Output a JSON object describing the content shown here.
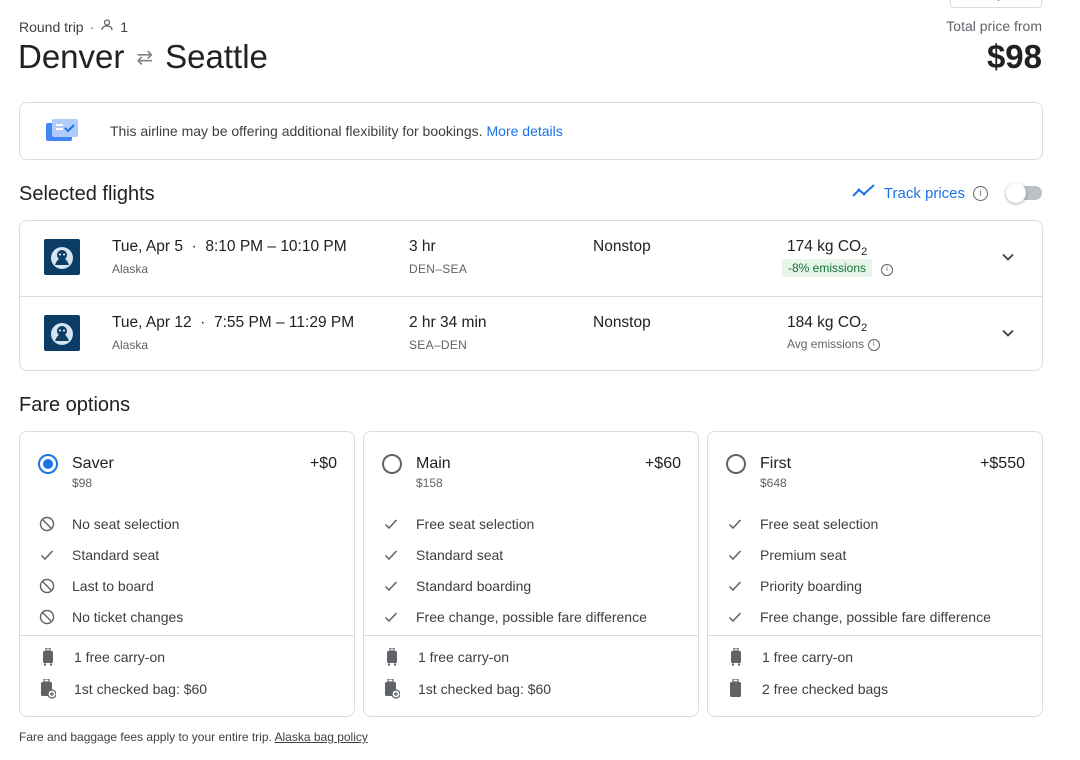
{
  "header": {
    "trip_type": "Round trip",
    "passengers": "1",
    "origin": "Denver",
    "destination": "Seattle",
    "total_price_label": "Total price from",
    "total_price": "$98"
  },
  "banner": {
    "text": "This airline may be offering additional flexibility for bookings.",
    "link": "More details"
  },
  "selected_flights": {
    "title": "Selected flights",
    "track_prices_label": "Track prices",
    "track_enabled": false,
    "flights": [
      {
        "date": "Tue, Apr 5",
        "times": "8:10 PM – 10:10 PM",
        "airline": "Alaska",
        "duration": "3 hr",
        "route": "DEN–SEA",
        "stops": "Nonstop",
        "co2_value": "174 kg CO",
        "emissions": "-8% emissions"
      },
      {
        "date": "Tue, Apr 12",
        "times": "7:55 PM – 11:29 PM",
        "airline": "Alaska",
        "duration": "2 hr 34 min",
        "route": "SEA–DEN",
        "stops": "Nonstop",
        "co2_value": "184 kg CO",
        "emissions": "Avg emissions"
      }
    ]
  },
  "fare_options": {
    "title": "Fare options",
    "fares": [
      {
        "name": "Saver",
        "base_price": "$98",
        "add_price": "+$0",
        "selected": true,
        "features": [
          {
            "icon": "block-icon",
            "text": "No seat selection"
          },
          {
            "icon": "check-icon",
            "text": "Standard seat"
          },
          {
            "icon": "block-icon",
            "text": "Last to board"
          },
          {
            "icon": "block-icon",
            "text": "No ticket changes"
          }
        ],
        "bags": [
          {
            "icon": "carry-on-icon",
            "text": "1 free carry-on"
          },
          {
            "icon": "checked-bag-fee-icon",
            "text": "1st checked bag: $60"
          }
        ]
      },
      {
        "name": "Main",
        "base_price": "$158",
        "add_price": "+$60",
        "selected": false,
        "features": [
          {
            "icon": "check-icon",
            "text": "Free seat selection"
          },
          {
            "icon": "check-icon",
            "text": "Standard seat"
          },
          {
            "icon": "check-icon",
            "text": "Standard boarding"
          },
          {
            "icon": "check-icon",
            "text": "Free change, possible fare difference"
          }
        ],
        "bags": [
          {
            "icon": "carry-on-icon",
            "text": "1 free carry-on"
          },
          {
            "icon": "checked-bag-fee-icon",
            "text": "1st checked bag: $60"
          }
        ]
      },
      {
        "name": "First",
        "base_price": "$648",
        "add_price": "+$550",
        "selected": false,
        "features": [
          {
            "icon": "check-icon",
            "text": "Free seat selection"
          },
          {
            "icon": "check-icon",
            "text": "Premium seat"
          },
          {
            "icon": "check-icon",
            "text": "Priority boarding"
          },
          {
            "icon": "check-icon",
            "text": "Free change, possible fare difference"
          }
        ],
        "bags": [
          {
            "icon": "carry-on-icon",
            "text": "1 free carry-on"
          },
          {
            "icon": "checked-bag-icon",
            "text": "2 free checked bags"
          }
        ]
      }
    ]
  },
  "footer": {
    "note": "Fare and baggage fees apply to your entire trip.",
    "link": "Alaska bag policy"
  },
  "colors": {
    "accent": "#1a73e8",
    "emissions_bg": "#e6f4ea",
    "emissions_text": "#137333",
    "alaska_logo": "#0b3d66"
  }
}
